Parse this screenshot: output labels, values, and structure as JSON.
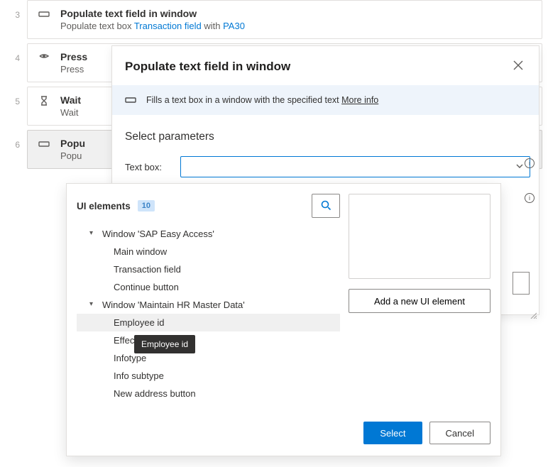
{
  "steps": [
    {
      "num": "3",
      "title": "Populate text field in window",
      "sub_a": "Populate text box ",
      "sub_link1": "Transaction field",
      "sub_b": " with ",
      "sub_link2": "PA30"
    },
    {
      "num": "4",
      "title": "Press",
      "sub": "Press"
    },
    {
      "num": "5",
      "title": "Wait",
      "sub": "Wait"
    },
    {
      "num": "6",
      "title": "Popu",
      "sub": "Popu"
    }
  ],
  "modal": {
    "title": "Populate text field in window",
    "banner": "Fills a text box in a window with the specified text ",
    "more": "More info",
    "section": "Select parameters",
    "param_label": "Text box:"
  },
  "popup": {
    "title": "UI elements",
    "count": "10",
    "add_label": "Add a new UI element",
    "select_label": "Select",
    "cancel_label": "Cancel",
    "tooltip": "Employee id",
    "tree": [
      {
        "type": "group",
        "label": "Window 'SAP Easy Access'"
      },
      {
        "type": "leaf",
        "label": "Main window"
      },
      {
        "type": "leaf",
        "label": "Transaction field"
      },
      {
        "type": "leaf",
        "label": "Continue button"
      },
      {
        "type": "group",
        "label": "Window 'Maintain HR Master Data'"
      },
      {
        "type": "leaf",
        "label": "Employee id",
        "selected": true
      },
      {
        "type": "leaf",
        "label": "Effecti"
      },
      {
        "type": "leaf",
        "label": "Infotype"
      },
      {
        "type": "leaf",
        "label": "Info subtype"
      },
      {
        "type": "leaf",
        "label": "New address button"
      }
    ]
  }
}
